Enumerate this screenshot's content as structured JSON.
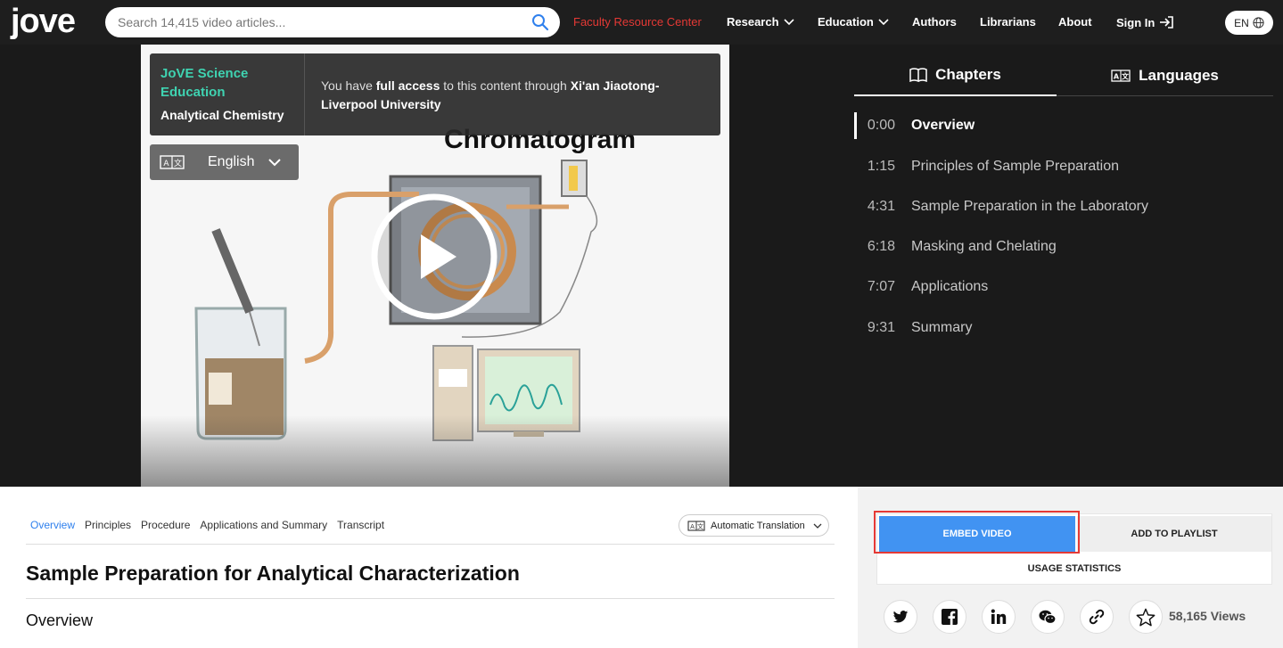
{
  "nav": {
    "logo": "jove",
    "search_placeholder": "Search 14,415 video articles...",
    "items": {
      "faculty": "Faculty Resource Center",
      "research": "Research",
      "education": "Education",
      "authors": "Authors",
      "librarians": "Librarians",
      "about": "About",
      "signin": "Sign In"
    },
    "language": "EN",
    "accent_red": "#e53935"
  },
  "video": {
    "brand": "JoVE Science Education",
    "subject": "Analytical Chemistry",
    "access_prefix": "You have ",
    "access_bold": "full access",
    "access_mid": " to this content through ",
    "access_institution": "Xi'an Jiaotong-Liverpool University",
    "language_select": "English",
    "frame_title": "Chromatogram",
    "brand_color": "#3fd3b1"
  },
  "panel": {
    "tabs": {
      "chapters": "Chapters",
      "languages": "Languages"
    },
    "chapters": [
      {
        "time": "0:00",
        "title": "Overview"
      },
      {
        "time": "1:15",
        "title": "Principles of Sample Preparation"
      },
      {
        "time": "4:31",
        "title": "Sample Preparation in the Laboratory"
      },
      {
        "time": "6:18",
        "title": "Masking and Chelating"
      },
      {
        "time": "7:07",
        "title": "Applications"
      },
      {
        "time": "9:31",
        "title": "Summary"
      }
    ]
  },
  "article": {
    "subtabs": [
      "Overview",
      "Principles",
      "Procedure",
      "Applications and Summary",
      "Transcript"
    ],
    "translation": "Automatic Translation",
    "title": "Sample Preparation for Analytical Characterization",
    "section": "Overview"
  },
  "actions": {
    "embed": "EMBED VIDEO",
    "playlist": "ADD TO PLAYLIST",
    "usage": "USAGE STATISTICS",
    "views": "58,165 Views",
    "embed_color": "#4193f2"
  }
}
